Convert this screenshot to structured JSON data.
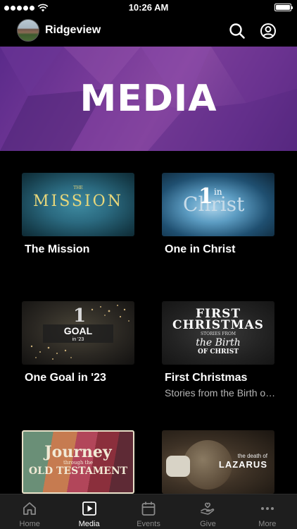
{
  "status_bar": {
    "time": "10:26 AM"
  },
  "header": {
    "title": "Ridgeview"
  },
  "banner": {
    "title": "MEDIA"
  },
  "thumb_text": {
    "mission_small": "THE",
    "mission_word": "MISSION",
    "onechrist_one": "1",
    "onechrist_in": "in",
    "onechrist_word": "Christ",
    "goal_num": "1",
    "goal_word": "GOAL",
    "goal_year": "in '23",
    "xmas_w1": "FIRST",
    "xmas_w2": "CHRISTMAS",
    "xmas_w3": "STORIES FROM",
    "xmas_w4": "the Birth",
    "xmas_w5": "OF CHRIST",
    "journey_w1": "Journey",
    "journey_w2": "through the",
    "journey_w3": "OLD TESTAMENT",
    "lazarus_w1": "the death of",
    "lazarus_w2": "LAZARUS"
  },
  "media": [
    {
      "title": "The Mission",
      "subtitle": ""
    },
    {
      "title": "One in Christ",
      "subtitle": ""
    },
    {
      "title": "One Goal in '23",
      "subtitle": ""
    },
    {
      "title": "First Christmas",
      "subtitle": "Stories from the Birth of Christ"
    },
    {
      "title": "",
      "subtitle": ""
    },
    {
      "title": "",
      "subtitle": ""
    }
  ],
  "tabs": [
    {
      "label": "Home",
      "icon": "home-icon",
      "active": false
    },
    {
      "label": "Media",
      "icon": "media-icon",
      "active": true
    },
    {
      "label": "Events",
      "icon": "calendar-icon",
      "active": false
    },
    {
      "label": "Give",
      "icon": "give-icon",
      "active": false
    },
    {
      "label": "More",
      "icon": "more-icon",
      "active": false
    }
  ]
}
